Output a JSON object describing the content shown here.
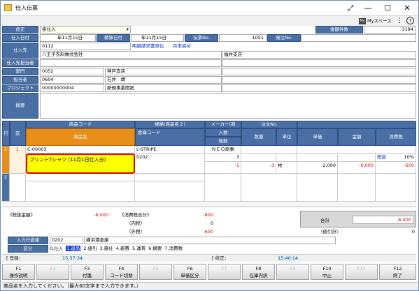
{
  "window": {
    "title": "仕入伝票",
    "controls": {
      "expand": "⤢",
      "minimize": "—",
      "maximize": "☐",
      "close": "✕"
    }
  },
  "toolbar": {
    "myspace_icon_text": "My",
    "myspace_label": "Myスペース",
    "menu": "⋮",
    "help": "?"
  },
  "header": {
    "shusei_label": "修正",
    "shusei_value": "掛仕入",
    "kinroku_label": "金額件数",
    "kinroku_value": "3184",
    "shiire_hizuke_label": "仕入日付",
    "shiire_hizuke_value": "年11月15日",
    "seisan_hizuke_label": "精算日付",
    "seisan_hizuke_value": "年11月15日",
    "denpyo_label": "伝票No.",
    "denpyo_value": "1051",
    "hacchu_label": "発注No.",
    "hacchu_value": "",
    "shiiresaki_label": "仕入先",
    "shiiresaki_code": "0112",
    "meisai_label": "明細請求書単位",
    "meisai_value": "月末締め",
    "shiiresaki_name": "八王子衣料株式会社",
    "shiten": "福井支店",
    "tantosha_label": "仕入先担当者",
    "bumon_label": "部門",
    "bumon_code": "0052",
    "bumon_name": "神戸支店",
    "tanto_label": "担当者",
    "tanto_code": "0604",
    "tanto_name": "石井　靖",
    "project_label": "プロジェクト",
    "project_code": "00000000004",
    "project_name": "新規事業開拓",
    "tekiyo_label": "摘要"
  },
  "grid": {
    "col_gyo": "行",
    "col_ku": "区",
    "col_shohin_code": "商品コード",
    "col_shohin_mei": "商品名",
    "col_kikaku": "規格(商品名２)",
    "col_soko": "倉庫コード",
    "col_maker": "メーカー(商",
    "col_irisu": "入数",
    "col_hakosu": "箱数",
    "col_chumon": "注文No.",
    "col_suryo": "数量",
    "col_tani": "単位",
    "col_tanka": "単価",
    "col_kingaku": "金額",
    "col_shohizei": "消費税",
    "rows": [
      {
        "no": "1",
        "ku": "1",
        "code": "C-00003",
        "name": "プリントTシャツ (11月1日仕入分)",
        "kikaku": "L-STRIPE",
        "soko": "0202",
        "maker": "ＮＥＯ商事",
        "irisu": "3",
        "hakosu": "-1",
        "suryo": "-3",
        "tani": "枚",
        "tanka": "2,000",
        "kingaku": "-6,000",
        "zei_kubun": "税抜",
        "zei_rate": "10%",
        "shohizei": "-600"
      },
      {
        "no": "2"
      }
    ]
  },
  "totals": {
    "zeinuki_label": "《税抜金額》",
    "zeinuki_value": "-6,000",
    "shohizei_label": "《消費税合計》",
    "shohizei_value": "-800",
    "uchizei_label": "〈内税〉",
    "uchizei_value": "0",
    "sotozei_label": "〈外税〉",
    "sotozei_value": "-600",
    "gokei_label": "合計",
    "gokei_value": "-6,000",
    "neshikei_label": "〈値引計〉",
    "neshikei_value": "0"
  },
  "footer": {
    "nyuryoku_soko_label": "入力行倉庫",
    "nyuryoku_soko_code": "0202",
    "nyuryoku_soko_name": "横浜港倉庫",
    "kubun_label": "区分",
    "kubun_options": [
      "0.仕入",
      "1.返品",
      "2.値引",
      "3.雑仕",
      "4.雑費",
      "5.運賃",
      "6.摘要",
      "7.消費税"
    ],
    "toroku_label": "登録：",
    "toroku_time": "15:37:34",
    "shusei_label": "修正：",
    "shusei_time": "15:40:14"
  },
  "fkeys": [
    {
      "key": "F1",
      "label": "操作説明",
      "enabled": true
    },
    {
      "key": "F2",
      "label": "",
      "enabled": false
    },
    {
      "key": "F3",
      "label": "付箋",
      "enabled": true
    },
    {
      "key": "F4",
      "label": "コード切替",
      "enabled": true
    },
    {
      "key": "F5",
      "label": "",
      "enabled": false
    },
    {
      "key": "F6",
      "label": "単価区分",
      "enabled": true
    },
    {
      "key": "F7",
      "label": "",
      "enabled": false
    },
    {
      "key": "F8",
      "label": "在庫内訳",
      "enabled": true
    },
    {
      "key": "F9",
      "label": "",
      "enabled": false
    },
    {
      "key": "F10",
      "label": "中止",
      "enabled": true
    },
    {
      "key": "F11",
      "label": "",
      "enabled": false
    },
    {
      "key": "F12",
      "label": "終了",
      "enabled": true
    }
  ],
  "statusbar": {
    "message": "商品名を入力してください。（最大60文字まで入力できます。）"
  },
  "colors": {
    "label_bg": "#4a6fa5",
    "orange_header": "#e88f1a",
    "selected_row": "#ffff00",
    "highlight_border": "#e00000",
    "negative_text": "#e00000"
  }
}
